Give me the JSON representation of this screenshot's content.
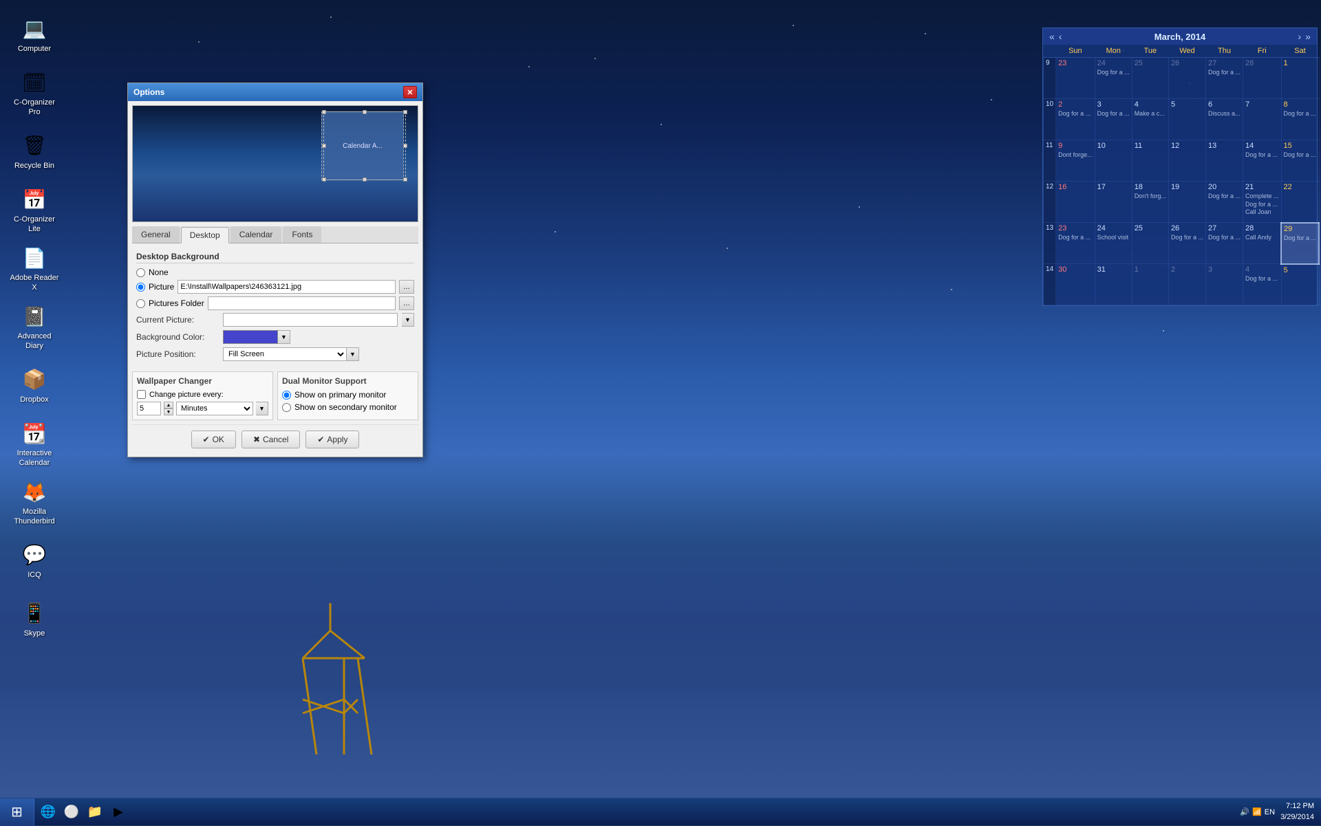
{
  "desktop": {
    "bg_color": "#1a3a6b"
  },
  "taskbar": {
    "start_label": "⊞",
    "time": "7:12 PM",
    "date": "3/29/2014",
    "lang": "EN",
    "icons": [
      {
        "name": "windows-icon",
        "symbol": "⊞"
      },
      {
        "name": "ie-icon",
        "symbol": "🌐"
      },
      {
        "name": "chrome-icon",
        "symbol": "⚪"
      },
      {
        "name": "explorer-icon",
        "symbol": "📁"
      },
      {
        "name": "media-icon",
        "symbol": "▶"
      }
    ]
  },
  "desktop_icons": [
    {
      "id": "computer",
      "label": "Computer",
      "symbol": "💻"
    },
    {
      "id": "c-organizer-pro",
      "label": "C-Organizer Pro",
      "symbol": "🗓"
    },
    {
      "id": "recycle-bin",
      "label": "Recycle Bin",
      "symbol": "🗑"
    },
    {
      "id": "c-organizer-lite",
      "label": "C-Organizer Lite",
      "symbol": "📅"
    },
    {
      "id": "adobe-reader",
      "label": "Adobe Reader X",
      "symbol": "📄"
    },
    {
      "id": "advanced-diary",
      "label": "Advanced Diary",
      "symbol": "📓"
    },
    {
      "id": "dropbox",
      "label": "Dropbox",
      "symbol": "📦"
    },
    {
      "id": "interactive-calendar",
      "label": "Interactive Calendar",
      "symbol": "📆"
    },
    {
      "id": "mozilla",
      "label": "Mozilla Thunderbird",
      "symbol": "🦊"
    },
    {
      "id": "icq",
      "label": "ICQ",
      "symbol": "💬"
    },
    {
      "id": "skype",
      "label": "Skype",
      "symbol": "📱"
    }
  ],
  "dialog": {
    "title": "Options",
    "tabs": [
      "General",
      "Desktop",
      "Calendar",
      "Fonts"
    ],
    "active_tab": "Desktop",
    "preview_calendar_label": "Calendar A...",
    "section_bg": "Desktop Background",
    "radio_none": "None",
    "radio_picture": "Picture",
    "radio_pictures_folder": "Pictures Folder",
    "label_current_picture": "Current Picture:",
    "label_bg_color": "Background Color:",
    "label_picture_position": "Picture Position:",
    "picture_path": "E:\\Install\\Wallpapers\\246363121.jpg",
    "picture_position": "Fill Screen",
    "wallpaper_changer_title": "Wallpaper Changer",
    "checkbox_change_every": "Change picture every:",
    "spinner_value": "5",
    "minutes_label": "Minutes",
    "dual_monitor_title": "Dual Monitor Support",
    "radio_primary": "Show on primary monitor",
    "radio_secondary": "Show on secondary monitor",
    "btn_ok": "OK",
    "btn_cancel": "Cancel",
    "btn_apply": "Apply"
  },
  "calendar": {
    "title": "March, 2014",
    "days_of_week": [
      "Sun",
      "Mon",
      "Tue",
      "Wed",
      "Thu",
      "Fri",
      "Sat"
    ],
    "weeks": [
      {
        "week_num": "9",
        "days": [
          {
            "date": "23",
            "month": "other",
            "events": []
          },
          {
            "date": "24",
            "month": "other",
            "events": [
              "Dog for a ..."
            ]
          },
          {
            "date": "25",
            "month": "other",
            "events": []
          },
          {
            "date": "26",
            "month": "other",
            "events": []
          },
          {
            "date": "27",
            "month": "other",
            "events": [
              "Dog for a ..."
            ]
          },
          {
            "date": "28",
            "month": "other",
            "events": []
          },
          {
            "date": "1",
            "month": "current",
            "events": []
          }
        ]
      },
      {
        "week_num": "10",
        "days": [
          {
            "date": "2",
            "month": "current",
            "events": [
              "Dog for a ..."
            ]
          },
          {
            "date": "3",
            "month": "current",
            "events": [
              "Dog for a ..."
            ]
          },
          {
            "date": "4",
            "month": "current",
            "events": [
              "Make a c..."
            ]
          },
          {
            "date": "5",
            "month": "current",
            "events": []
          },
          {
            "date": "6",
            "month": "current",
            "events": [
              "Discuss a..."
            ]
          },
          {
            "date": "7",
            "month": "current",
            "events": []
          },
          {
            "date": "8",
            "month": "current",
            "events": [
              "Dog for a ..."
            ]
          }
        ]
      },
      {
        "week_num": "11",
        "days": [
          {
            "date": "9",
            "month": "current",
            "events": [
              "Dont forge..."
            ]
          },
          {
            "date": "10",
            "month": "current",
            "events": []
          },
          {
            "date": "11",
            "month": "current",
            "events": []
          },
          {
            "date": "12",
            "month": "current",
            "events": []
          },
          {
            "date": "13",
            "month": "current",
            "events": []
          },
          {
            "date": "14",
            "month": "current",
            "events": [
              "Dog for a ..."
            ]
          },
          {
            "date": "15",
            "month": "current",
            "events": [
              "Dog for a ..."
            ]
          }
        ]
      },
      {
        "week_num": "12",
        "days": [
          {
            "date": "16",
            "month": "current",
            "events": []
          },
          {
            "date": "17",
            "month": "current",
            "events": []
          },
          {
            "date": "18",
            "month": "current",
            "events": [
              "Don't forg..."
            ]
          },
          {
            "date": "19",
            "month": "current",
            "events": []
          },
          {
            "date": "20",
            "month": "current",
            "events": [
              "Dog for a ..."
            ]
          },
          {
            "date": "21",
            "month": "current",
            "events": [
              "Complete ...",
              "Dog for a ...",
              "Call Joan"
            ]
          },
          {
            "date": "22",
            "month": "current",
            "events": []
          }
        ]
      },
      {
        "week_num": "13",
        "days": [
          {
            "date": "23",
            "month": "current",
            "events": [
              "Dog for a ..."
            ]
          },
          {
            "date": "24",
            "month": "current",
            "events": [
              "School visit"
            ]
          },
          {
            "date": "25",
            "month": "current",
            "events": []
          },
          {
            "date": "26",
            "month": "current",
            "events": [
              "Dog for a ..."
            ]
          },
          {
            "date": "27",
            "month": "current",
            "events": [
              "Dog for a ..."
            ]
          },
          {
            "date": "28",
            "month": "current",
            "events": [
              "Call Andy"
            ]
          },
          {
            "date": "29",
            "month": "current",
            "events": [
              "Dog for a ..."
            ],
            "selected": true
          }
        ]
      },
      {
        "week_num": "14",
        "days": [
          {
            "date": "30",
            "month": "current",
            "events": []
          },
          {
            "date": "31",
            "month": "current",
            "events": []
          },
          {
            "date": "1",
            "month": "next",
            "events": []
          },
          {
            "date": "2",
            "month": "next",
            "events": []
          },
          {
            "date": "3",
            "month": "next",
            "events": []
          },
          {
            "date": "4",
            "month": "next",
            "events": [
              "Dog for a ..."
            ]
          },
          {
            "date": "5",
            "month": "next",
            "events": []
          }
        ]
      }
    ]
  }
}
